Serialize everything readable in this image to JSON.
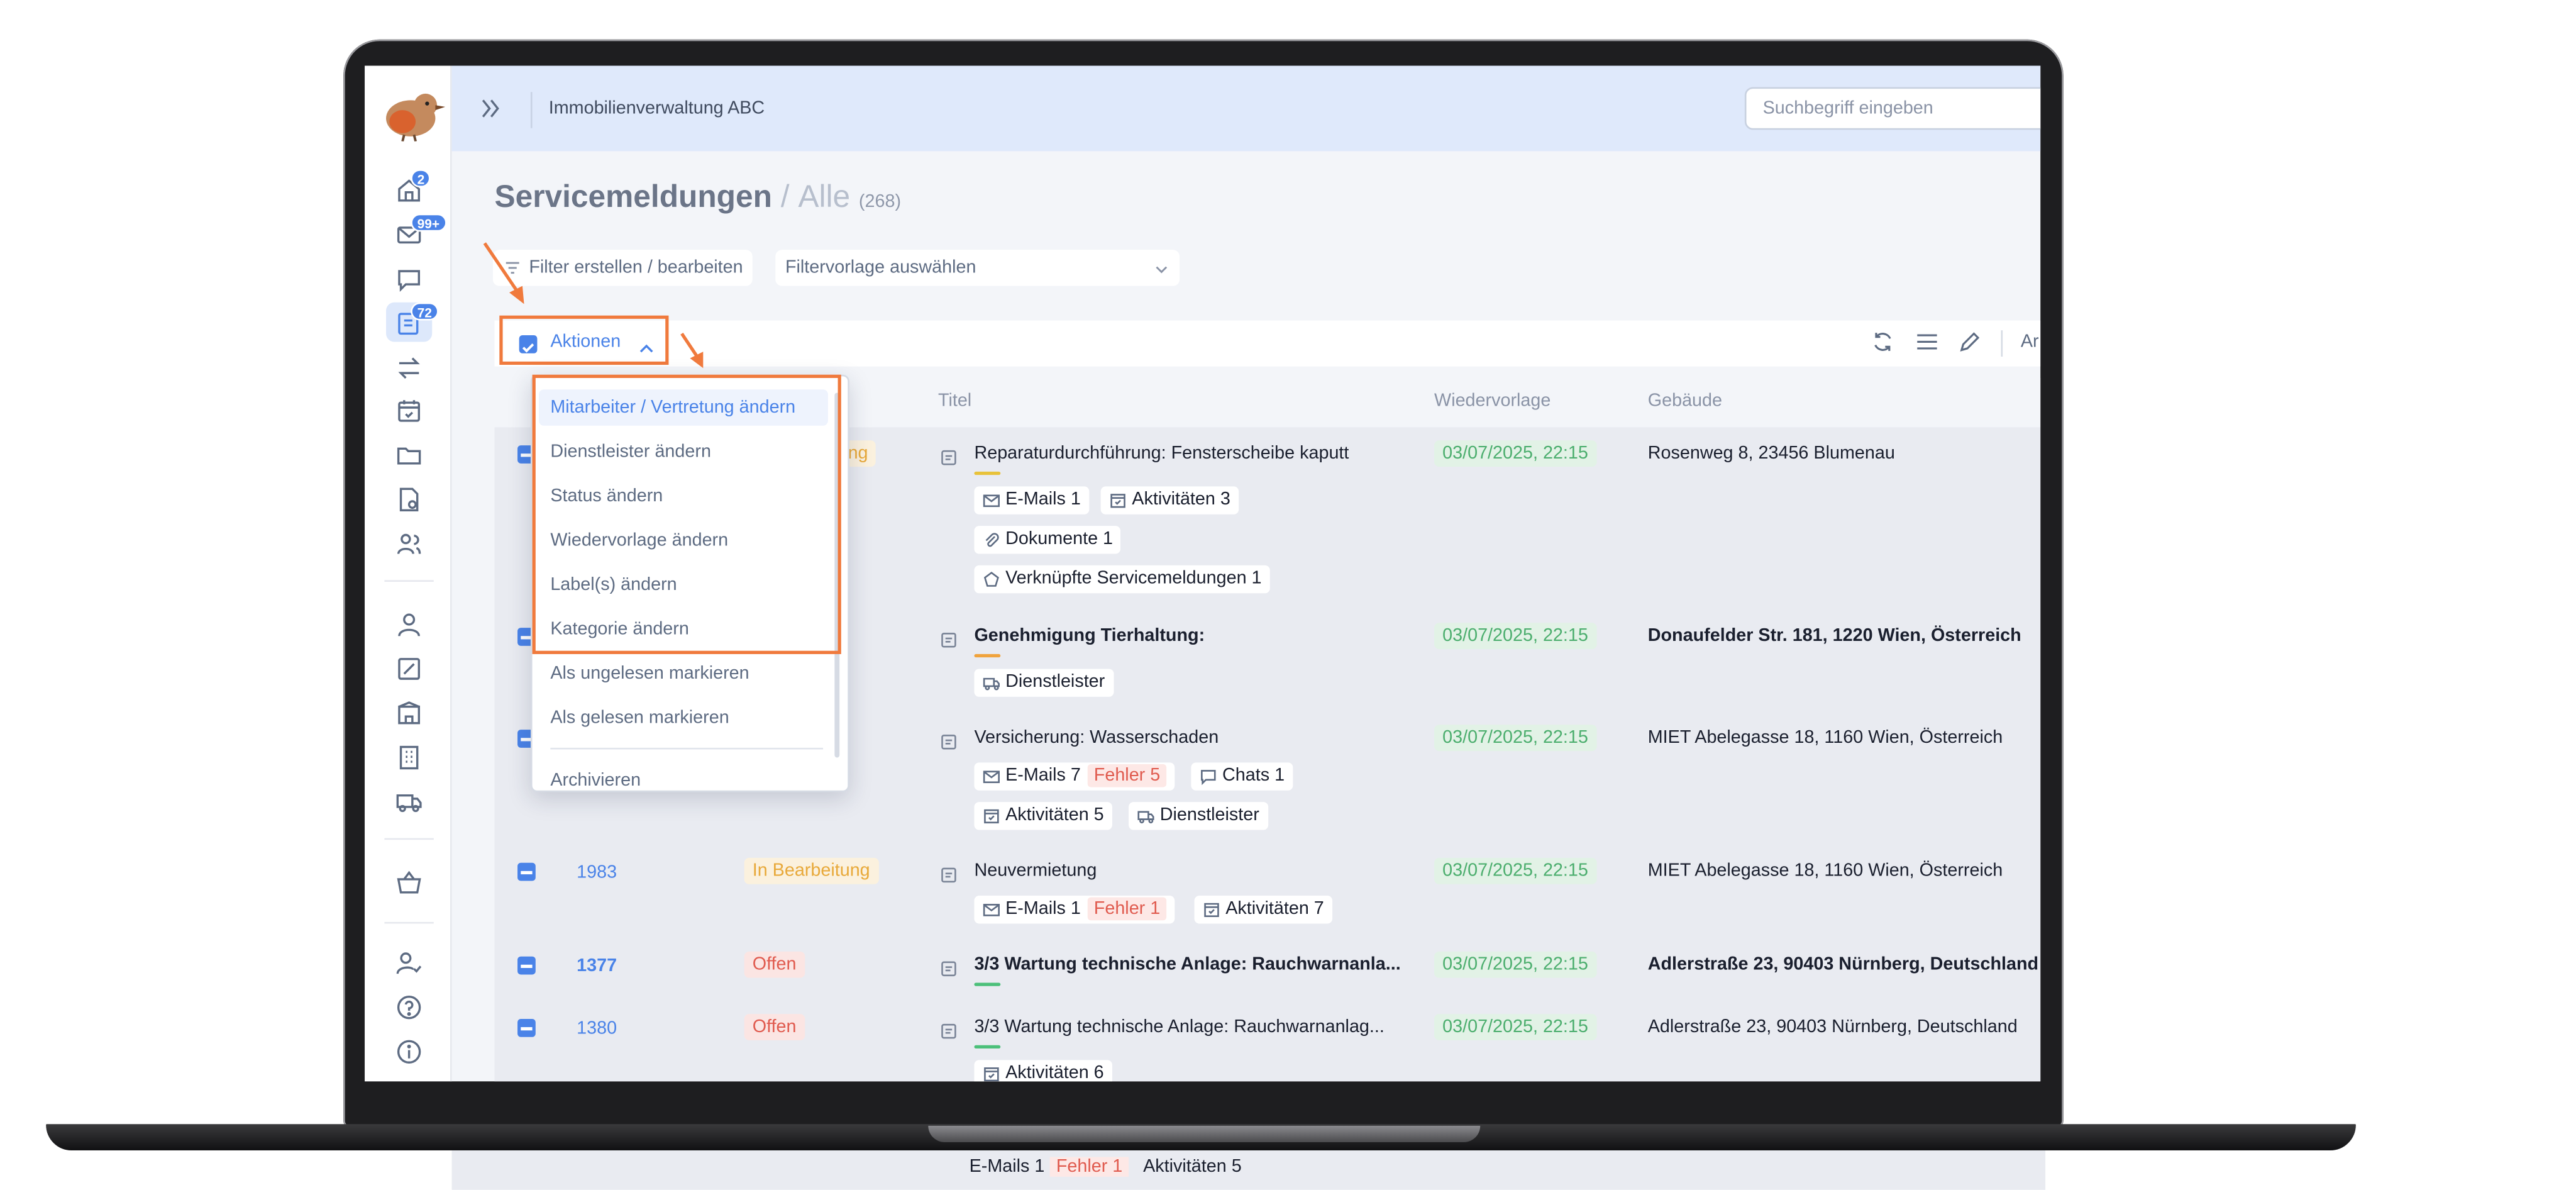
{
  "topbar": {
    "org_name": "Immobilienverwaltung ABC",
    "search_placeholder": "Suchbegriff eingeben"
  },
  "sidebar": {
    "badges": {
      "home": "2",
      "mail": "99+",
      "tickets": "72"
    }
  },
  "page": {
    "title": "Servicemeldungen",
    "separator": "/",
    "filter_name": "Alle",
    "count": "(268)"
  },
  "filters": {
    "edit_label": "Filter erstellen / bearbeiten",
    "template_placeholder": "Filtervorlage auswählen"
  },
  "toolbar": {
    "actions_label": "Aktionen",
    "cut_label": "Ar"
  },
  "table": {
    "headers": {
      "title": "Titel",
      "followup": "Wiedervorlage",
      "building": "Gebäude"
    },
    "rows": [
      {
        "id": "",
        "status": "ung",
        "title": "Reparaturdurchführung: Fensterscheibe kaputt",
        "date": "03/07/2025, 22:15",
        "building": "Rosenweg 8, 23456 Blumenau",
        "chips": {
          "emails": "E-Mails 1",
          "activities": "Aktivitäten 3",
          "docs": "Dokumente 1",
          "linked": "Verknüpfte Servicemeldungen 1"
        }
      },
      {
        "title": "Genehmigung Tierhaltung:",
        "date": "03/07/2025, 22:15",
        "building": "Donaufelder Str. 181, 1220 Wien, Österreich",
        "chips": {
          "provider": "Dienstleister"
        }
      },
      {
        "title": "Versicherung: Wasserschaden",
        "date": "03/07/2025, 22:15",
        "building": "MIET Abelegasse 18, 1160 Wien, Österreich",
        "chips": {
          "emails": "E-Mails 7",
          "error": "Fehler 5",
          "chats": "Chats 1",
          "activities": "Aktivitäten 5",
          "provider": "Dienstleister"
        }
      },
      {
        "id": "1983",
        "status": "In Bearbeitung",
        "title": "Neuvermietung",
        "date": "03/07/2025, 22:15",
        "building": "MIET Abelegasse 18, 1160 Wien, Österreich",
        "chips": {
          "emails": "E-Mails 1",
          "error": "Fehler 1",
          "activities": "Aktivitäten 7"
        }
      },
      {
        "id": "1377",
        "status": "Offen",
        "title": "3/3 Wartung technische Anlage: Rauchwarnanla...",
        "date": "03/07/2025, 22:15",
        "building": "Adlerstraße 23, 90403 Nürnberg, Deutschland"
      },
      {
        "id": "1380",
        "status": "Offen",
        "title": "3/3 Wartung technische Anlage: Rauchwarnanlag...",
        "date": "03/07/2025, 22:15",
        "building": "Adlerstraße 23, 90403 Nürnberg, Deutschland",
        "chips": {
          "activities": "Aktivitäten 6"
        }
      }
    ],
    "below": {
      "emails": "E-Mails 1",
      "error": "Fehler 1",
      "activities": "Aktivitäten 5"
    }
  },
  "dropdown": {
    "items": [
      "Mitarbeiter / Vertretung ändern",
      "Dienstleister ändern",
      "Status ändern",
      "Wiedervorlage ändern",
      "Label(s) ändern",
      "Kategorie ändern",
      "Als ungelesen markieren",
      "Als gelesen markieren",
      "Archivieren"
    ]
  },
  "colors": {
    "accent": "#4a83e8",
    "highlight": "#f07a3d",
    "date_green": "#4cae6e",
    "status_orange": "#e8a93a",
    "status_red": "#e05b4f"
  }
}
